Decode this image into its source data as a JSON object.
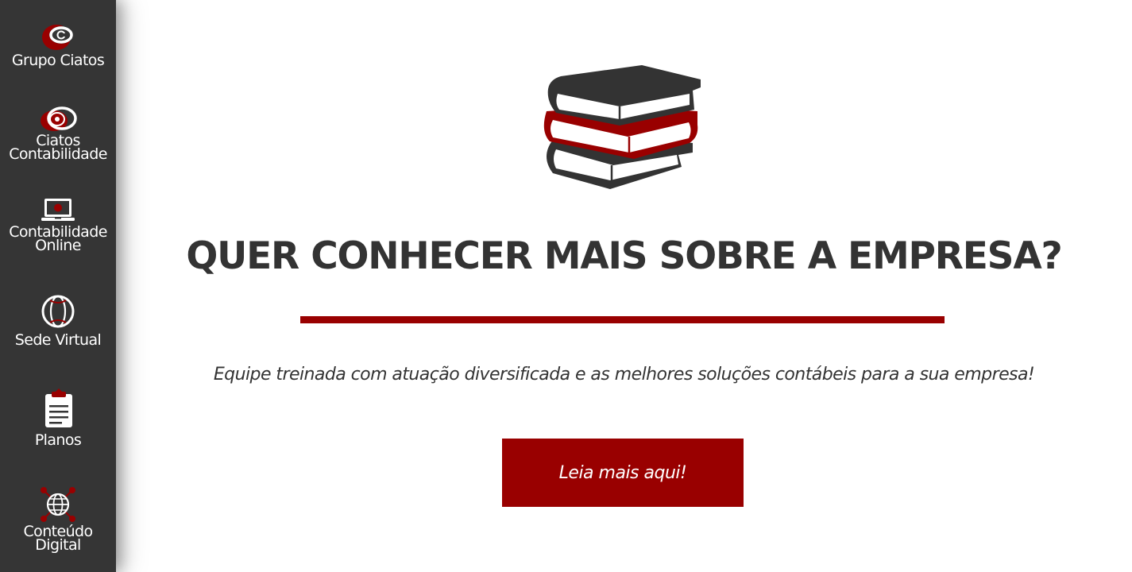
{
  "colors": {
    "sidebar_bg": "#353535",
    "accent": "#990000",
    "text": "#333333",
    "white": "#ffffff"
  },
  "sidebar": {
    "items": [
      {
        "label": "Grupo Ciatos",
        "icon": "ciatos-logo-icon"
      },
      {
        "label": "Ciatos\nContabilidade",
        "icon": "ciatos-contabilidade-logo-icon"
      },
      {
        "label": "Contabilidade\nOnline",
        "icon": "laptop-icon"
      },
      {
        "label": "Sede Virtual",
        "icon": "globe-outline-icon"
      },
      {
        "label": "Planos",
        "icon": "clipboard-icon"
      },
      {
        "label": "Conteúdo\nDigital",
        "icon": "network-globe-icon"
      }
    ]
  },
  "main": {
    "illustration": "stacked-books-icon",
    "headline": "QUER CONHECER MAIS SOBRE A EMPRESA?",
    "tagline": "Equipe treinada com atuação diversificada e as melhores soluções contábeis para a sua empresa!",
    "cta_label": "Leia mais aqui!"
  }
}
